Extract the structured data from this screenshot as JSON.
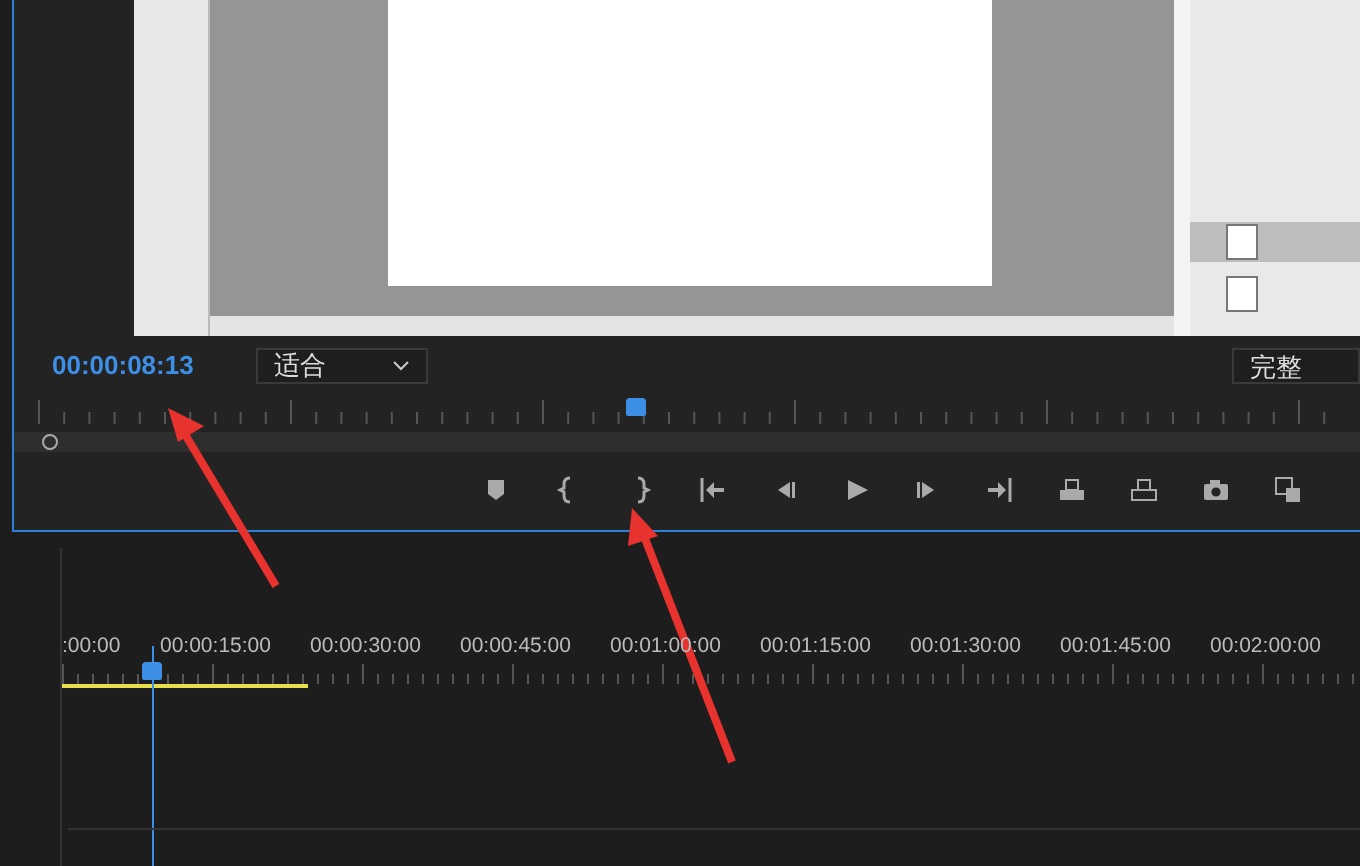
{
  "program_monitor": {
    "timecode": "00:00:08:13",
    "zoom_select": "适合",
    "quality_select": "完整"
  },
  "timeline": {
    "ruler_labels": [
      ":00:00",
      "00:00:15:00",
      "00:00:30:00",
      "00:00:45:00",
      "00:01:00:00",
      "00:01:15:00",
      "00:01:30:00",
      "00:01:45:00",
      "00:02:00:00"
    ]
  }
}
